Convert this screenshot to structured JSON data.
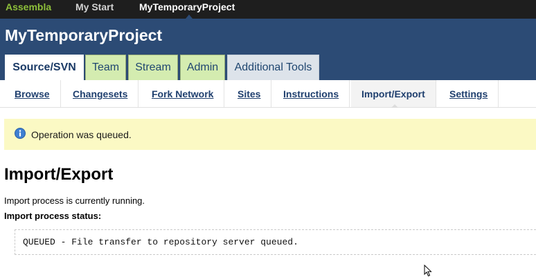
{
  "topbar": {
    "brand": "Assembla",
    "my_start": "My Start",
    "project": "MyTemporaryProject"
  },
  "header": {
    "title": "MyTemporaryProject"
  },
  "tabs": [
    {
      "label": "Source/SVN",
      "active": true
    },
    {
      "label": "Team"
    },
    {
      "label": "Stream"
    },
    {
      "label": "Admin"
    },
    {
      "label": "Additional Tools"
    }
  ],
  "subnav": [
    {
      "label": "Browse"
    },
    {
      "label": "Changesets"
    },
    {
      "label": "Fork Network"
    },
    {
      "label": "Sites"
    },
    {
      "label": "Instructions"
    },
    {
      "label": "Import/Export",
      "current": true
    },
    {
      "label": "Settings"
    }
  ],
  "notice": {
    "icon": "info-icon",
    "message": "Operation was queued."
  },
  "content": {
    "title": "Import/Export",
    "status_line": "Import process is currently running.",
    "status_label": "Import process status:",
    "status_code": "QUEUED - File transfer to repository server queued."
  },
  "colors": {
    "header_bg": "#2c4b75",
    "topbar_bg": "#1e1e1e",
    "brand": "#8dbf3a",
    "tab_green": "#d4ecb0",
    "notice_bg": "#fbf9c4"
  }
}
